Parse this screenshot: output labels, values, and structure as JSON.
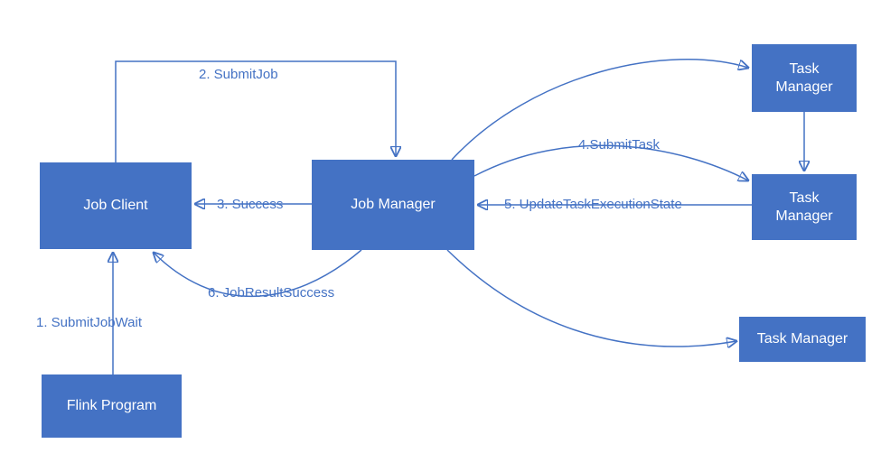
{
  "colors": {
    "box_fill": "#4472C4",
    "box_text": "#ffffff",
    "edge": "#4472C4"
  },
  "nodes": {
    "flink_program": {
      "label": "Flink Program"
    },
    "job_client": {
      "label": "Job Client"
    },
    "job_manager": {
      "label": "Job Manager"
    },
    "task_manager_1": {
      "label": "Task\nManager"
    },
    "task_manager_2": {
      "label": "Task\nManager"
    },
    "task_manager_3": {
      "label": "Task Manager"
    }
  },
  "edges": {
    "e1": {
      "from": "flink_program",
      "to": "job_client",
      "label": "1. SubmitJobWait"
    },
    "e2": {
      "from": "job_client",
      "to": "job_manager",
      "label": "2. SubmitJob"
    },
    "e3": {
      "from": "job_manager",
      "to": "job_client",
      "label": "3. Success"
    },
    "e4": {
      "from": "job_manager",
      "to": "task_manager_2",
      "label": "4.SubmitTask"
    },
    "e5": {
      "from": "task_manager_2",
      "to": "job_manager",
      "label": "5. UpdateTaskExecutionState"
    },
    "e6": {
      "from": "job_manager",
      "to": "job_client",
      "label": "6. JobResultSuccess"
    }
  }
}
